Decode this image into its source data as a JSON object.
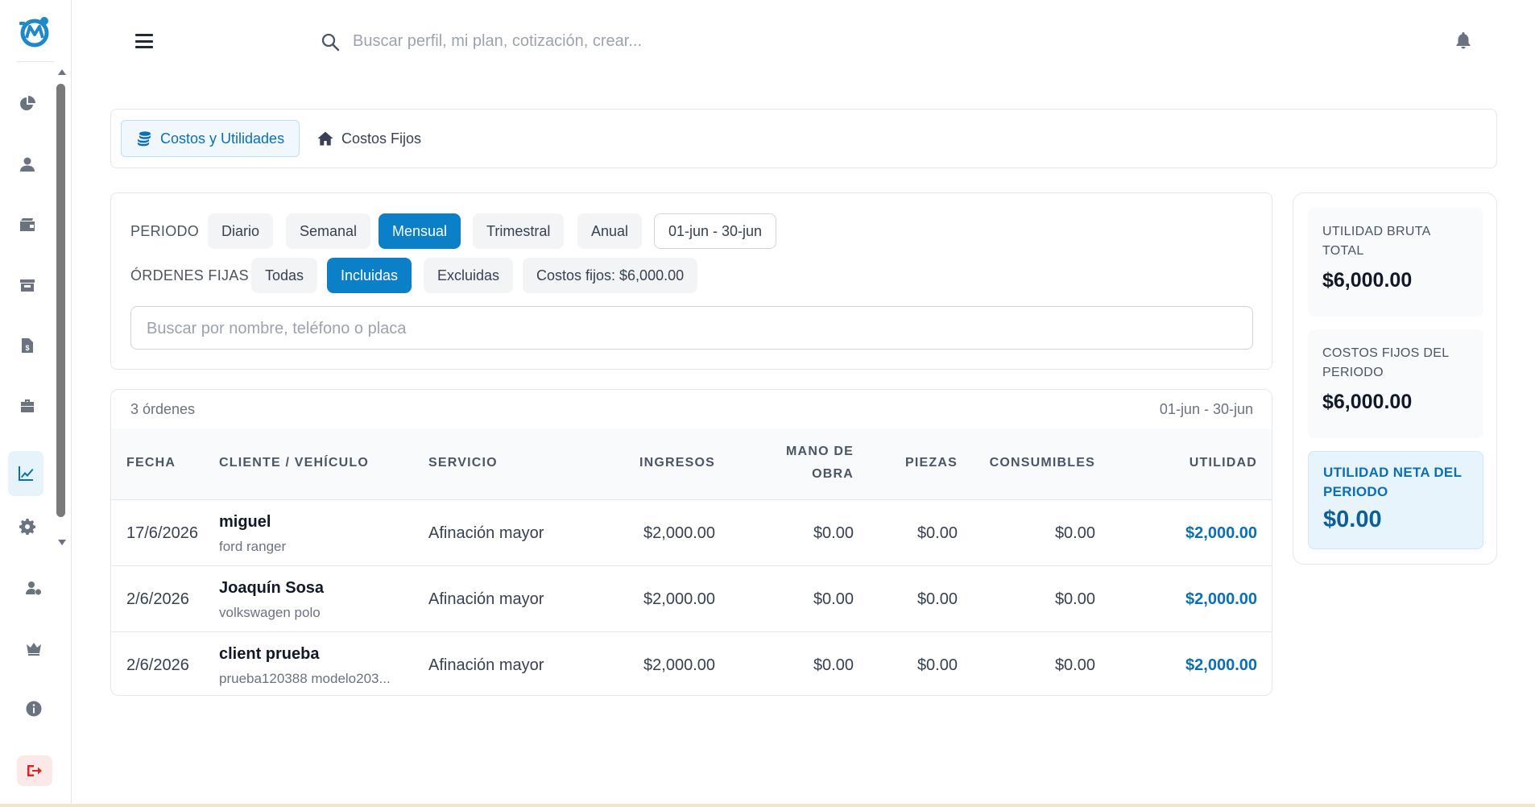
{
  "topbar": {
    "search_placeholder": "Buscar perfil, mi plan, cotización, crear..."
  },
  "tabs": [
    {
      "label": "Costos y Utilidades",
      "icon": "coins-icon",
      "active": true
    },
    {
      "label": "Costos Fijos",
      "icon": "home-icon",
      "active": false
    }
  ],
  "filters": {
    "period_label": "PERIODO",
    "period_options": [
      "Diario",
      "Semanal",
      "Mensual",
      "Trimestral",
      "Anual"
    ],
    "period_selected": "Mensual",
    "date_range": "01-jun - 30-jun",
    "fixed_orders_label": "ÓRDENES FIJAS",
    "fixed_orders_options": [
      "Todas",
      "Incluidas",
      "Excluidas"
    ],
    "fixed_orders_selected": "Incluidas",
    "fixed_costs_chip": "Costos fijos: $6,000.00",
    "search_placeholder": "Buscar por nombre, teléfono o placa"
  },
  "table": {
    "count_label": "3 órdenes",
    "range_label": "01-jun - 30-jun",
    "headers": {
      "fecha": "FECHA",
      "cliente": "CLIENTE / VEHÍCULO",
      "servicio": "SERVICIO",
      "ingresos": "INGRESOS",
      "mano_obra_1": "MANO DE",
      "mano_obra_2": "OBRA",
      "piezas": "PIEZAS",
      "consumibles": "CONSUMIBLES",
      "utilidad": "UTILIDAD"
    },
    "rows": [
      {
        "fecha": "17/6/2026",
        "cliente": "miguel",
        "vehiculo": "ford ranger",
        "servicio": "Afinación mayor",
        "ingresos": "$2,000.00",
        "mano_obra": "$0.00",
        "piezas": "$0.00",
        "consumibles": "$0.00",
        "utilidad": "$2,000.00"
      },
      {
        "fecha": "2/6/2026",
        "cliente": "Joaquín Sosa",
        "vehiculo": "volkswagen polo",
        "servicio": "Afinación mayor",
        "ingresos": "$2,000.00",
        "mano_obra": "$0.00",
        "piezas": "$0.00",
        "consumibles": "$0.00",
        "utilidad": "$2,000.00"
      },
      {
        "fecha": "2/6/2026",
        "cliente": "client prueba",
        "vehiculo": "prueba120388 modelo203...",
        "servicio": "Afinación mayor",
        "ingresos": "$2,000.00",
        "mano_obra": "$0.00",
        "piezas": "$0.00",
        "consumibles": "$0.00",
        "utilidad": "$2,000.00"
      }
    ]
  },
  "summary": {
    "gross": {
      "label": "UTILIDAD BRUTA TOTAL",
      "value": "$6,000.00"
    },
    "fixed": {
      "label": "COSTOS FIJOS DEL PERIODO",
      "value": "$6,000.00"
    },
    "net": {
      "label": "UTILIDAD NETA DEL PERIODO",
      "value": "$0.00"
    }
  },
  "sidebar": {
    "icons": [
      "dashboard-pie-icon",
      "user-icon",
      "wallet-icon",
      "store-icon",
      "invoice-icon",
      "briefcase-icon",
      "chart-line-icon",
      "gear-icon",
      "users-cog-icon",
      "crown-icon",
      "info-icon",
      "logout-icon"
    ],
    "active_icon": "chart-line-icon"
  },
  "colors": {
    "accent": "#0b80c8",
    "accent_text": "#0b6fb8",
    "logout": "#e02424"
  }
}
